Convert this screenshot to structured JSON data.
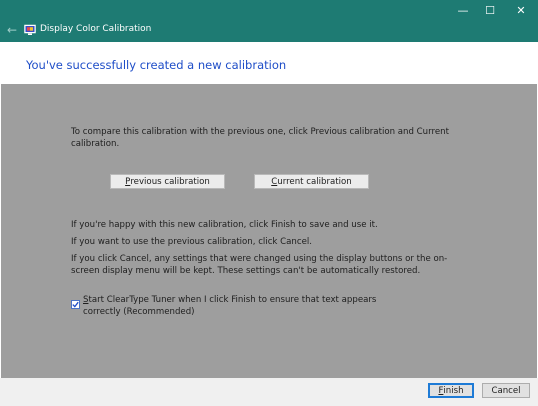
{
  "window": {
    "title": "Display Color Calibration",
    "controls": {
      "minimize": "—",
      "maximize": "☐",
      "close": "✕"
    },
    "back_icon": "back-arrow-icon",
    "app_icon": "display-icon"
  },
  "header": {
    "title": "You've successfully created a new calibration"
  },
  "main": {
    "compare_text": "To compare this calibration with the previous one, click Previous calibration and Current calibration.",
    "previous_button": {
      "underline": "P",
      "rest": "revious calibration"
    },
    "current_button": {
      "underline": "C",
      "rest": "urrent calibration"
    },
    "finish_info": "If you're happy with this new calibration, click Finish to save and use it.",
    "cancel_info": "If you want to use the previous calibration, click Cancel.",
    "cancel_warning": "If you click Cancel, any settings that were changed using the display buttons or the on-screen display menu will be kept. These settings can't be automatically restored.",
    "cleartype_checkbox": {
      "checked": true,
      "underline": "S",
      "rest": "tart ClearType Tuner when I click Finish to ensure that text appears correctly (Recommended)"
    }
  },
  "footer": {
    "finish_button": {
      "underline": "F",
      "rest": "inish"
    },
    "cancel_button": "Cancel"
  },
  "colors": {
    "titlebar": "#1e7b73",
    "header_text": "#1f4ec8",
    "content_bg": "#9e9e9e"
  }
}
